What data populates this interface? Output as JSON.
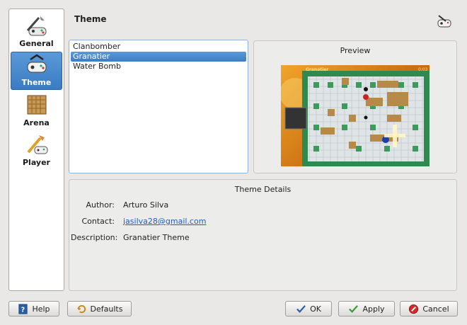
{
  "sidebar": {
    "items": [
      {
        "label": "General",
        "icon": "general-icon"
      },
      {
        "label": "Theme",
        "icon": "theme-icon"
      },
      {
        "label": "Arena",
        "icon": "arena-icon"
      },
      {
        "label": "Player",
        "icon": "player-icon"
      }
    ],
    "active": "Theme"
  },
  "page": {
    "title": "Theme",
    "icon": "theme-gamepad-icon"
  },
  "themes": {
    "items": [
      "Clanbomber",
      "Granatier",
      "Water Bomb"
    ],
    "selected": "Granatier"
  },
  "preview": {
    "label": "Preview",
    "game_title": "Granatier",
    "game_time": "0:03"
  },
  "details": {
    "title": "Theme Details",
    "author_label": "Author:",
    "author": "Arturo Silva",
    "contact_label": "Contact:",
    "contact": "jasilva28@gmail.com",
    "description_label": "Description:",
    "description": "Granatier Theme"
  },
  "buttons": {
    "help": "Help",
    "defaults": "Defaults",
    "ok": "OK",
    "apply": "Apply",
    "cancel": "Cancel"
  },
  "colors": {
    "selection": "#3d7dc5",
    "link": "#1c5fb8"
  }
}
